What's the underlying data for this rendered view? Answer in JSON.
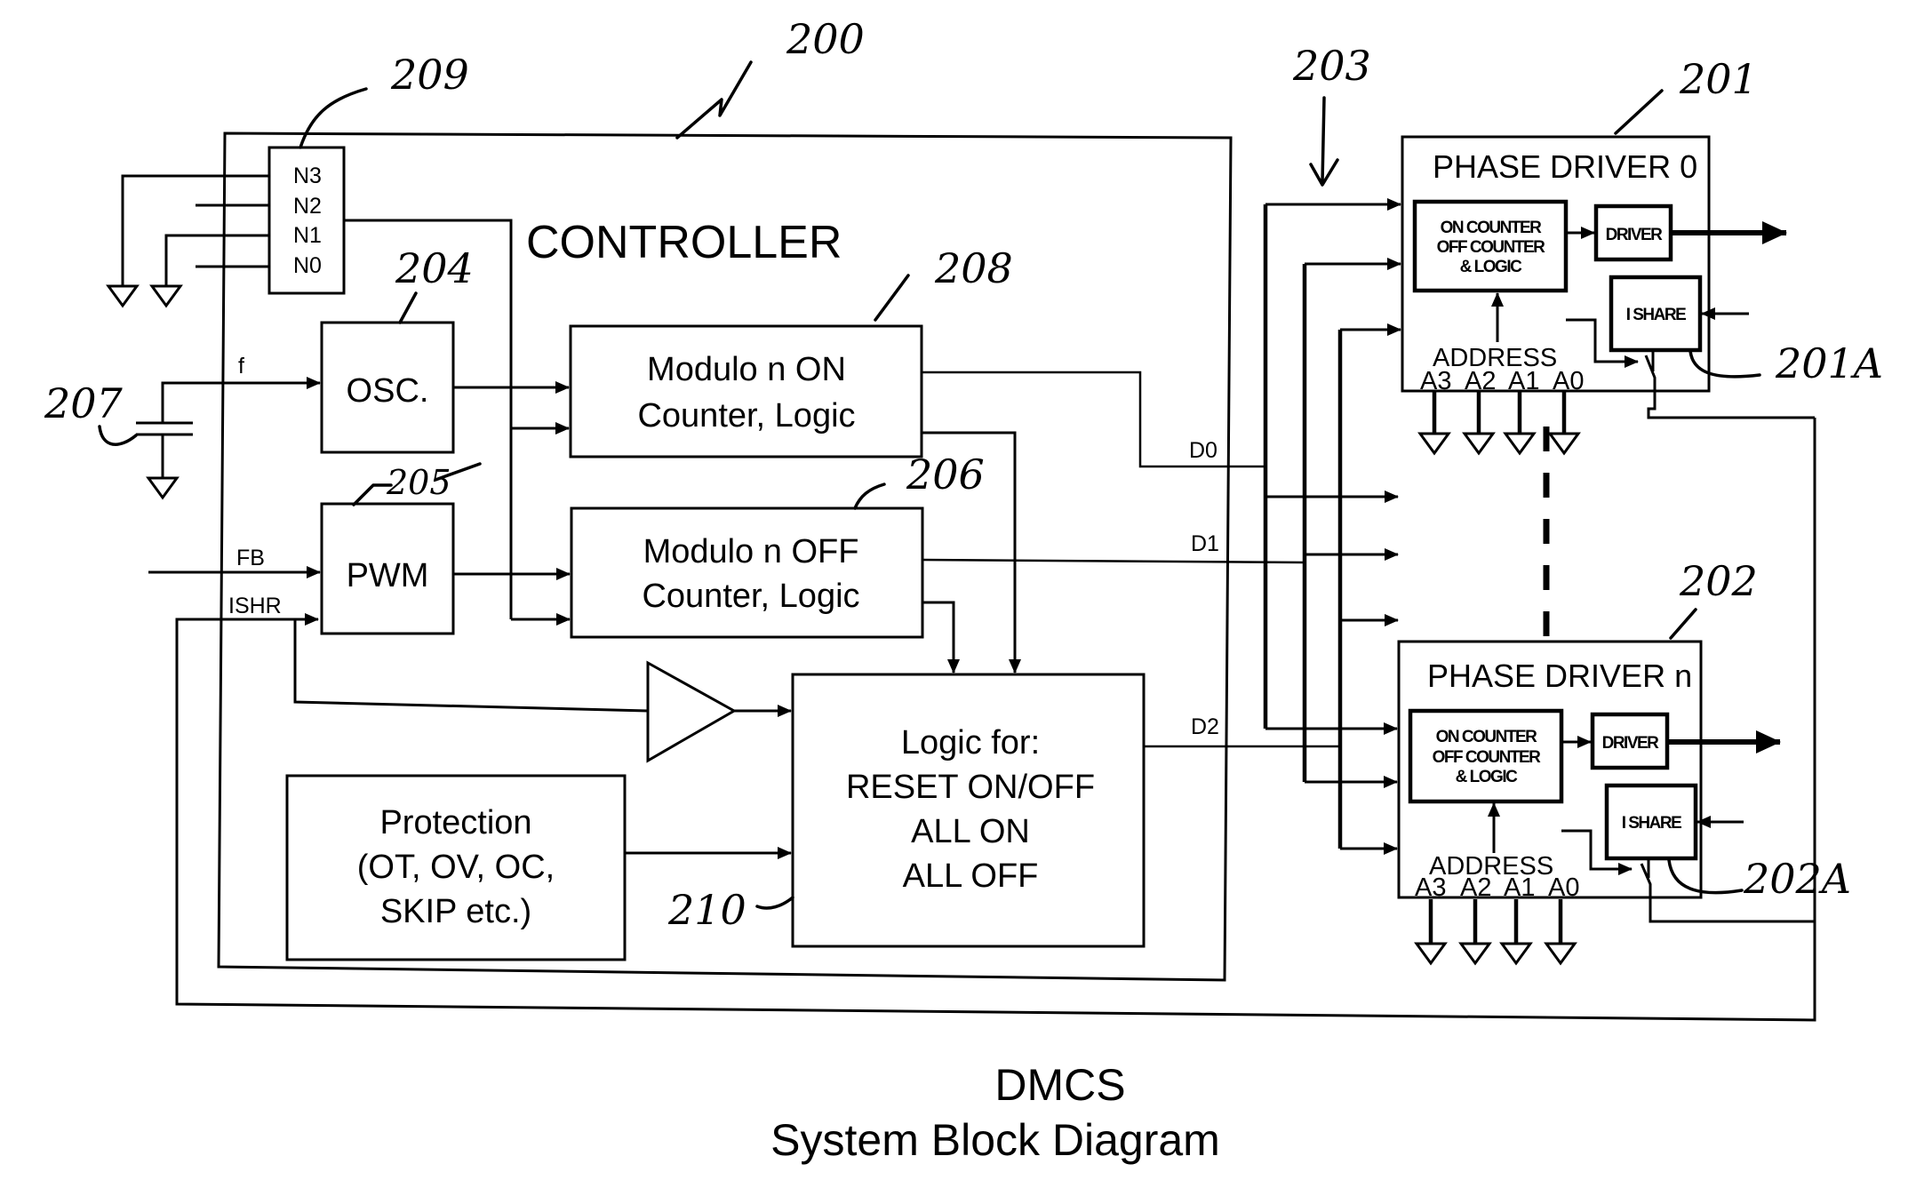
{
  "figure": {
    "title_line1": "DMCS",
    "title_line2": "System Block Diagram"
  },
  "controller": {
    "label": "CONTROLLER",
    "ref": "200",
    "pins": {
      "ref": "209",
      "n3": "N3",
      "n2": "N2",
      "n1": "N1",
      "n0": "N0"
    },
    "osc": {
      "label": "OSC.",
      "ref": "204",
      "input": "f"
    },
    "capacitor_ref": "207",
    "pwm": {
      "label": "PWM",
      "ref": "205",
      "input_fb": "FB",
      "input_ishr": "ISHR"
    },
    "on_counter": {
      "line1": "Modulo n ON",
      "line2": "Counter, Logic",
      "ref": "208"
    },
    "off_counter": {
      "line1": "Modulo n OFF",
      "line2": "Counter, Logic",
      "ref": "206"
    },
    "protection": {
      "line1": "Protection",
      "line2": "(OT, OV, OC,",
      "line3": "SKIP etc.)"
    },
    "logic": {
      "line1": "Logic for:",
      "line2": "RESET ON/OFF",
      "line3": "ALL ON",
      "line4": "ALL OFF",
      "ref": "210"
    },
    "outputs": {
      "d0": "D0",
      "d1": "D1",
      "d2": "D2"
    }
  },
  "bus": {
    "ref": "203"
  },
  "phase_drivers": [
    {
      "title": "PHASE DRIVER 0",
      "ref": "201",
      "counter_line1": "ON COUNTER",
      "counter_line2": "OFF COUNTER",
      "counter_line3": "& LOGIC",
      "driver": "DRIVER",
      "ishare": "I SHARE",
      "ishare_ref": "201A",
      "address": "ADDRESS",
      "a3": "A3",
      "a2": "A2",
      "a1": "A1",
      "a0": "A0"
    },
    {
      "title": "PHASE DRIVER n",
      "ref": "202",
      "counter_line1": "ON COUNTER",
      "counter_line2": "OFF COUNTER",
      "counter_line3": "& LOGIC",
      "driver": "DRIVER",
      "ishare": "I SHARE",
      "ishare_ref": "202A",
      "address": "ADDRESS",
      "a3": "A3",
      "a2": "A2",
      "a1": "A1",
      "a0": "A0"
    }
  ]
}
